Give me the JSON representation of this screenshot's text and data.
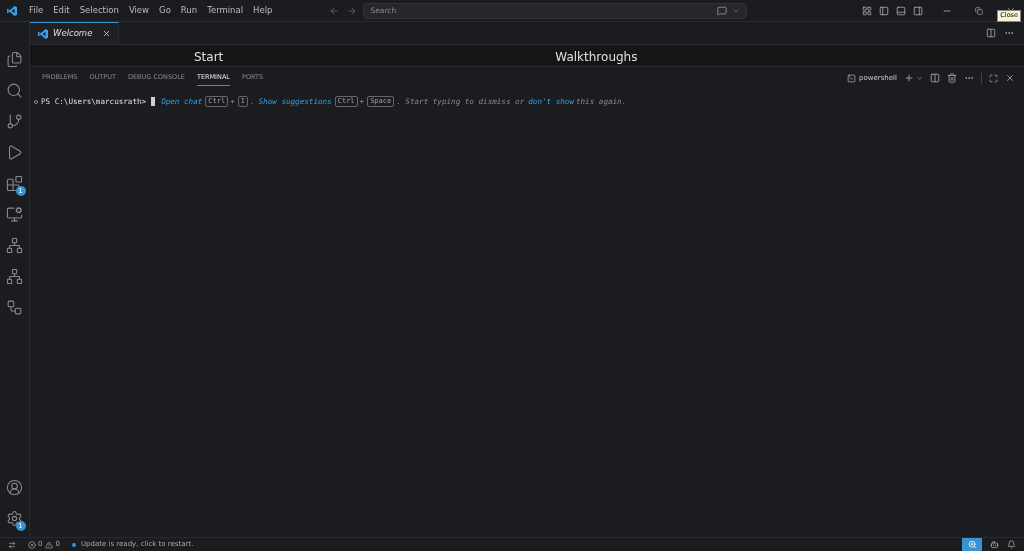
{
  "menu": [
    "File",
    "Edit",
    "Selection",
    "View",
    "Go",
    "Run",
    "Terminal",
    "Help"
  ],
  "search": {
    "placeholder": "Search"
  },
  "tooltip": "Close",
  "activity": [
    {
      "kind": "files"
    },
    {
      "kind": "search"
    },
    {
      "kind": "git"
    },
    {
      "kind": "debug"
    },
    {
      "kind": "extensions",
      "badge": "1"
    },
    {
      "kind": "remote"
    },
    {
      "kind": "tree"
    },
    {
      "kind": "tree2"
    },
    {
      "kind": "diagram"
    }
  ],
  "activity_bottom": [
    {
      "kind": "account"
    },
    {
      "kind": "settings",
      "badge": "1"
    }
  ],
  "tabs": [
    {
      "label": "Welcome",
      "selected": true
    }
  ],
  "editor_headings": [
    "Start",
    "Walkthroughs"
  ],
  "panel_tabs": [
    {
      "label": "PROBLEMS",
      "selected": false
    },
    {
      "label": "OUTPUT",
      "selected": false
    },
    {
      "label": "DEBUG CONSOLE",
      "selected": false
    },
    {
      "label": "TERMINAL",
      "selected": true
    },
    {
      "label": "PORTS",
      "selected": false
    }
  ],
  "terminal_profile": "powershell",
  "terminal": {
    "prompt": "PS C:\\Users\\marcusrath>",
    "hint": [
      {
        "kind": "link",
        "text": "Open chat"
      },
      {
        "kind": "key",
        "text": "Ctrl"
      },
      {
        "kind": "text",
        "text": "+"
      },
      {
        "kind": "key",
        "text": "I"
      },
      {
        "kind": "text",
        "text": "."
      },
      {
        "kind": "link",
        "text": "Show suggestions"
      },
      {
        "kind": "key",
        "text": "Ctrl"
      },
      {
        "kind": "text",
        "text": "+"
      },
      {
        "kind": "key",
        "text": "Space"
      },
      {
        "kind": "text",
        "text": ". Start typing to dismiss or"
      },
      {
        "kind": "link",
        "text": "don't show"
      },
      {
        "kind": "text",
        "text": "this again."
      }
    ]
  },
  "status": {
    "errors": "0",
    "warnings": "0",
    "message": "Update is ready, click to restart."
  }
}
